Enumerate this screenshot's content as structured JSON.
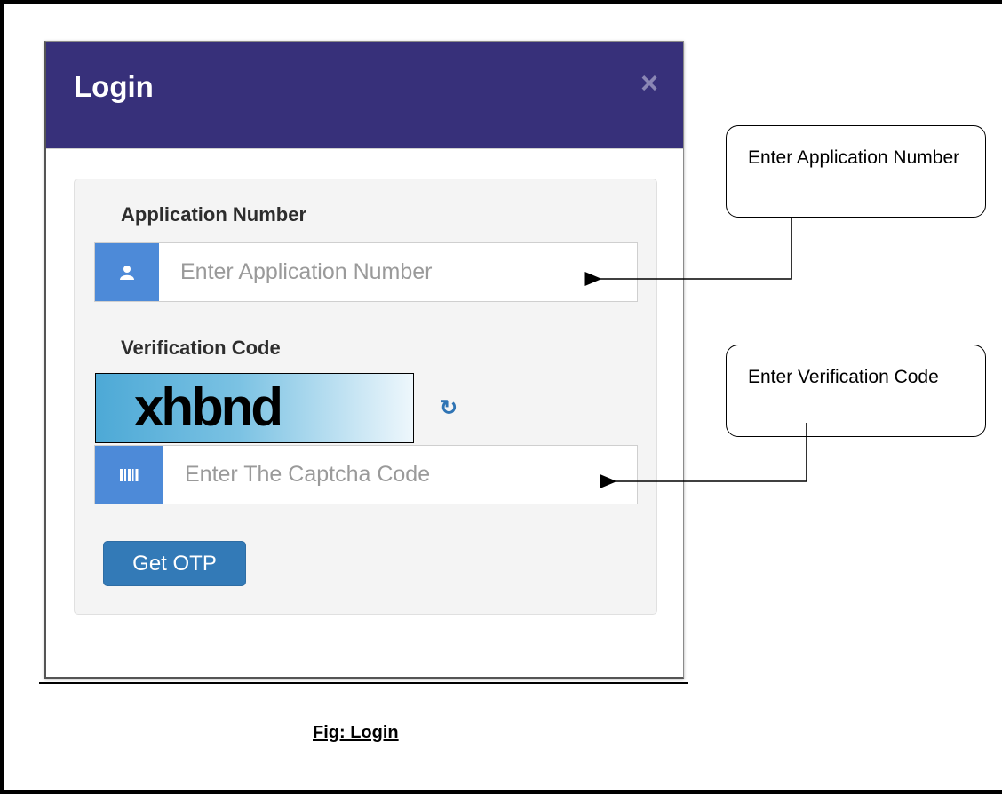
{
  "modal": {
    "title": "Login",
    "close_glyph": "×"
  },
  "form": {
    "application_number": {
      "label": "Application Number",
      "placeholder": "Enter Application Number",
      "value": "",
      "icon": "user-icon"
    },
    "verification": {
      "label": "Verification Code",
      "captcha_text": "xhbnd",
      "refresh_icon": "refresh-icon",
      "placeholder": "Enter The Captcha Code",
      "value": "",
      "icon": "barcode-icon"
    },
    "submit_label": "Get OTP"
  },
  "callouts": {
    "application": "Enter Application Number",
    "verification": "Enter Verification Code"
  },
  "caption": "Fig: Login",
  "colors": {
    "header": "#37307a",
    "addon": "#4d8ad8",
    "button": "#337ab7",
    "panel": "#f4f4f4"
  }
}
